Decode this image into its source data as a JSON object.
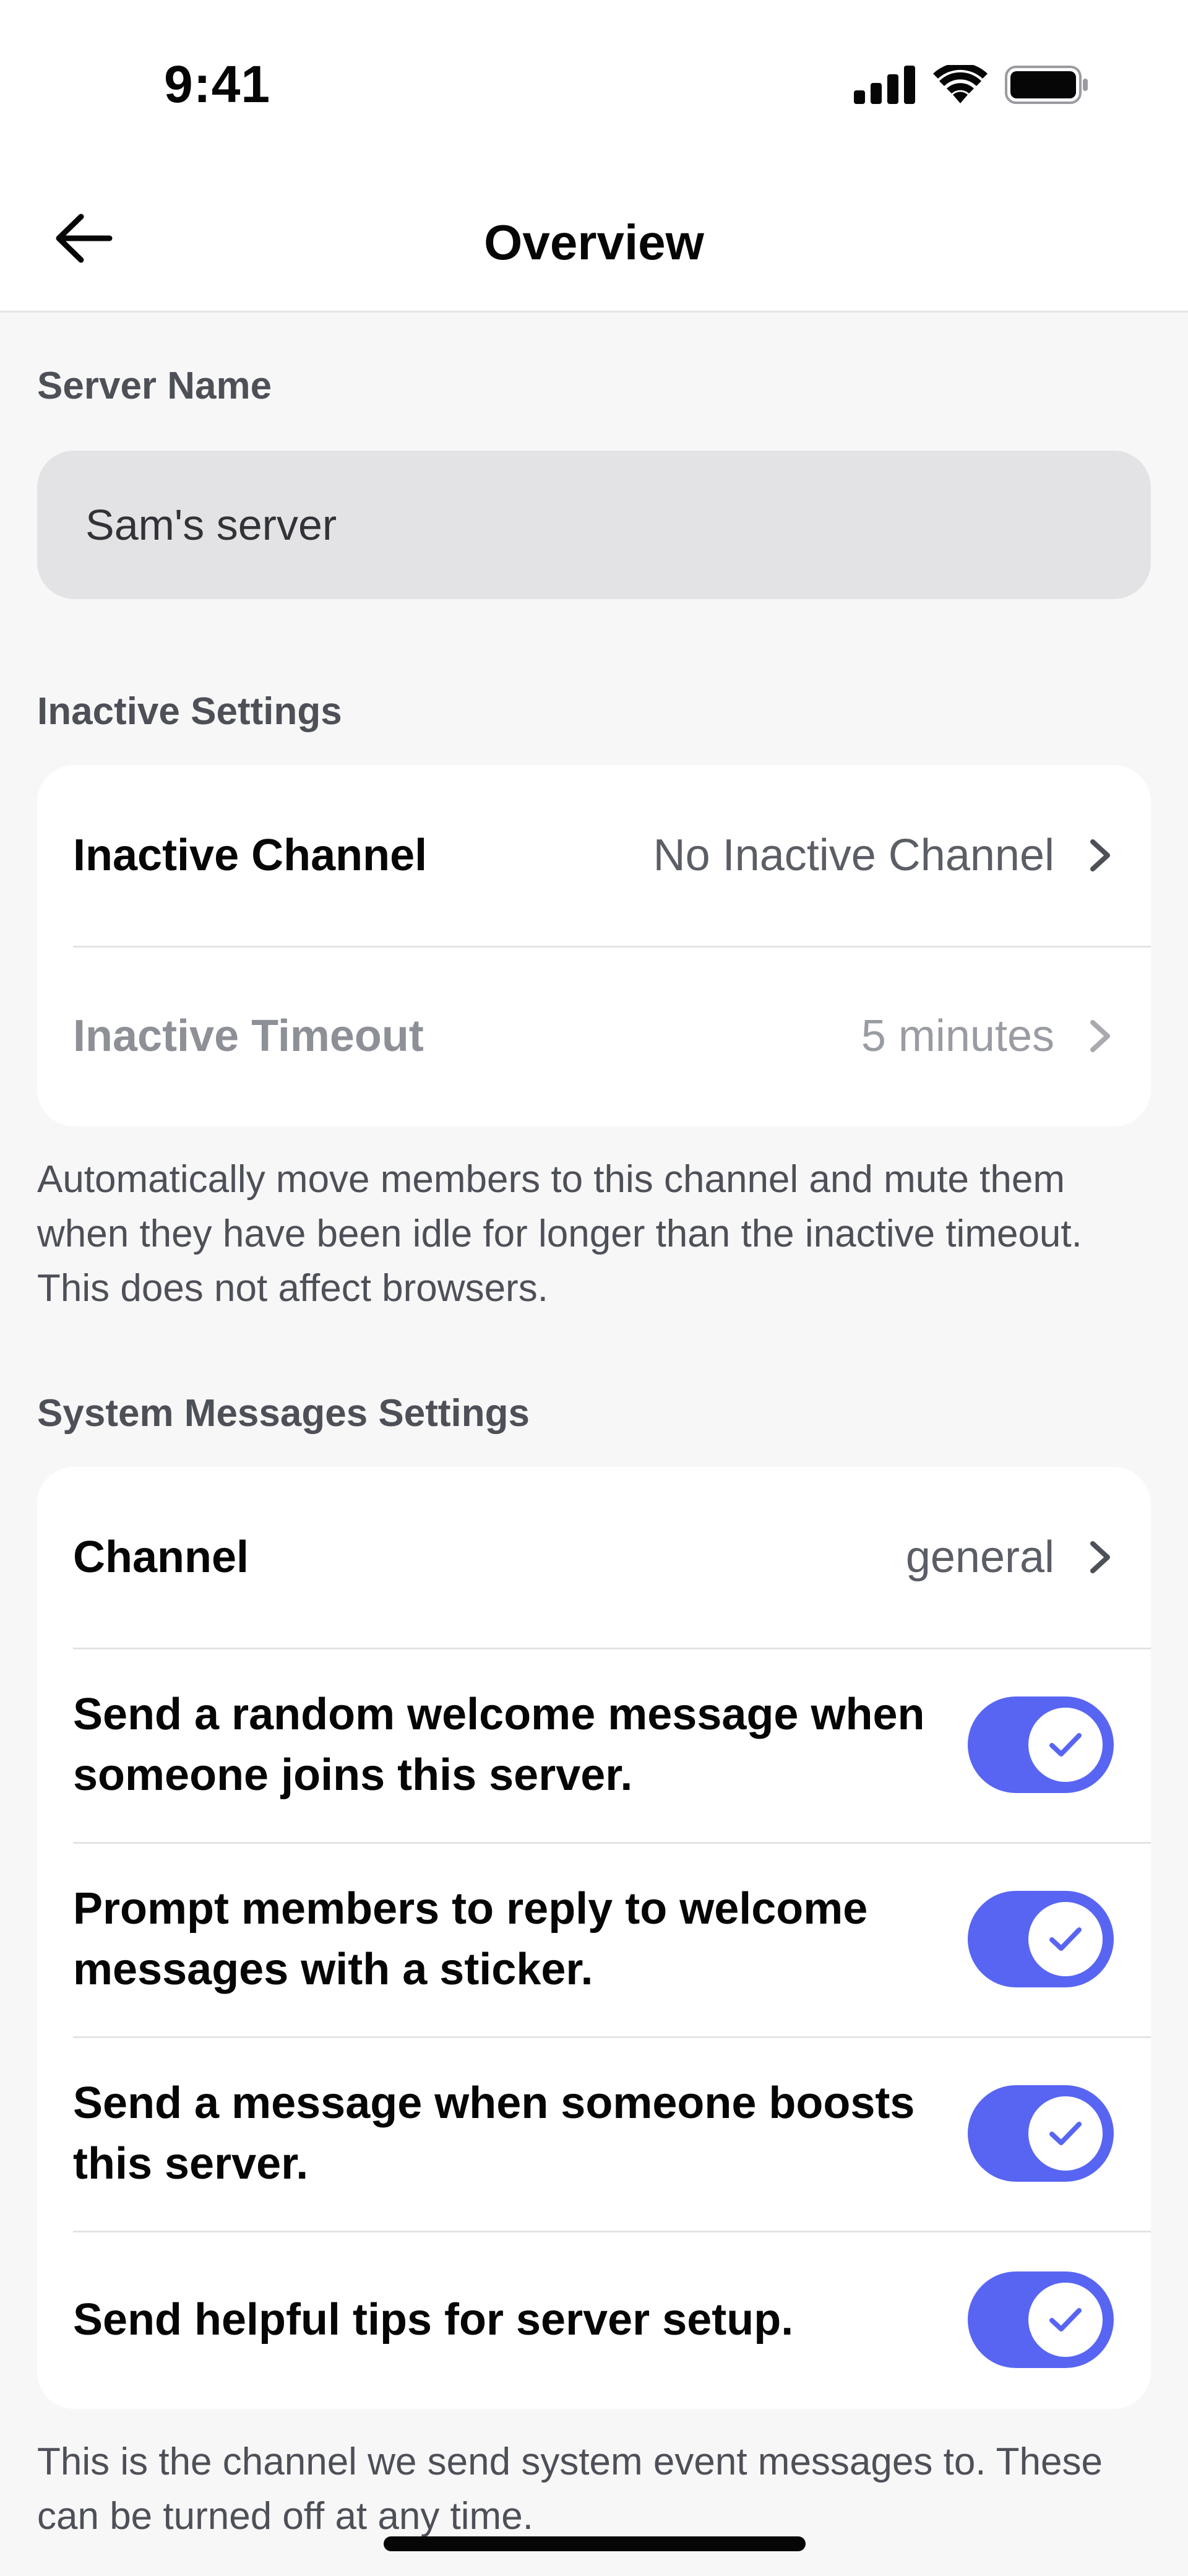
{
  "status_bar": {
    "time": "9:41"
  },
  "nav": {
    "title": "Overview"
  },
  "server_name": {
    "label": "Server Name",
    "value": "Sam's server"
  },
  "inactive": {
    "label": "Inactive Settings",
    "channel_label": "Inactive Channel",
    "channel_value": "No Inactive Channel",
    "timeout_label": "Inactive Timeout",
    "timeout_value": "5 minutes",
    "helper": "Automatically move members to this channel and mute them when they have been idle for longer than the inactive timeout. This does not affect browsers."
  },
  "system": {
    "label": "System Messages Settings",
    "channel_label": "Channel",
    "channel_value": "general",
    "toggles": [
      {
        "label": "Send a random welcome message when someone joins this server.",
        "on": true
      },
      {
        "label": "Prompt members to reply to welcome messages with a sticker.",
        "on": true
      },
      {
        "label": "Send a message when someone boosts this server.",
        "on": true
      },
      {
        "label": "Send helpful tips for server setup.",
        "on": true
      }
    ],
    "helper": "This is the channel we send system event messages to. These can be turned off at any time."
  },
  "colors": {
    "accent": "#5865f2",
    "background": "#f7f7f8",
    "card": "#ffffff"
  }
}
